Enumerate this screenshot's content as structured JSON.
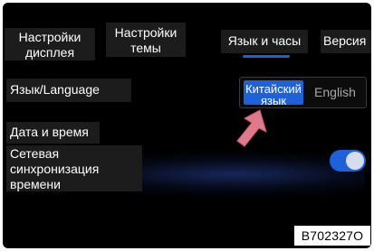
{
  "tabs": [
    {
      "label": "Настройки дисплея"
    },
    {
      "label": "Настройки темы"
    },
    {
      "label": "Язык и часы"
    },
    {
      "label": "Версия"
    }
  ],
  "active_tab": "Язык и часы",
  "settings": {
    "language_label": "Язык/Language",
    "language_options": [
      "Китайский язык",
      "English"
    ],
    "language_selected": "Китайский язык",
    "date_time_label": "Дата и время",
    "network_sync_label": "Сетевая синхронизация времени",
    "network_sync_enabled": true
  },
  "figure_code": "B702327O",
  "colors": {
    "accent": "#1d62d8",
    "background": "#000000",
    "label_background": "#1c1c1c",
    "arrow": "#e07a8a"
  },
  "icons": {
    "pointer": "arrow-icon"
  }
}
